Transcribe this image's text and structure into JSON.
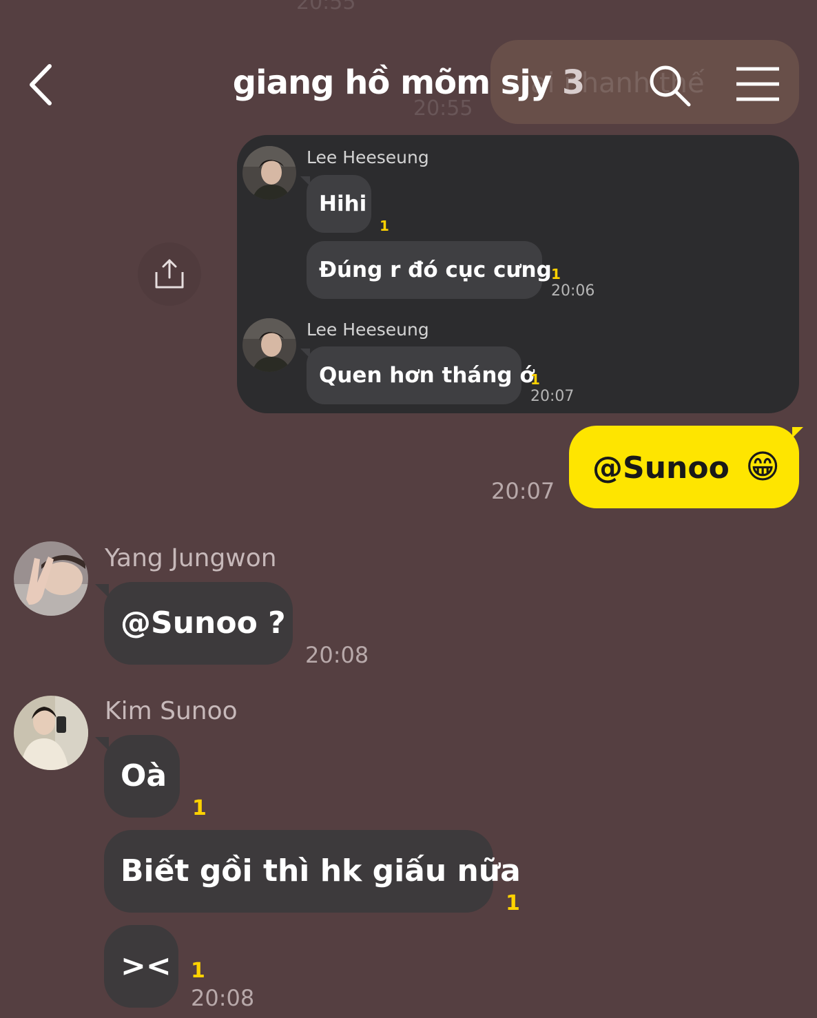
{
  "background_ghost": {
    "top_time": "20:55",
    "mid_time": "20:55",
    "bubble_text": "ai nhanh thế"
  },
  "header": {
    "title": "giang hồ mõm sjy",
    "member_count": "3",
    "back_icon": "chevron-left-icon",
    "search_icon": "search-icon",
    "menu_icon": "hamburger-menu-icon"
  },
  "forwarded": {
    "share_icon": "share-upload-icon",
    "groups": [
      {
        "sender": "Lee Heeseung",
        "messages": [
          {
            "text": "Hihi",
            "unread": "1",
            "time": ""
          },
          {
            "text": "Đúng r đó cục cưng",
            "unread": "1",
            "time": "20:06"
          }
        ]
      },
      {
        "sender": "Lee Heeseung",
        "messages": [
          {
            "text": "Quen hơn tháng ớ",
            "unread": "1",
            "time": "20:07"
          }
        ]
      }
    ]
  },
  "my_message": {
    "text": "@Sunoo",
    "emoji": "😁",
    "time": "20:07"
  },
  "messages": [
    {
      "sender": "Yang Jungwon",
      "bubbles": [
        {
          "text": "@Sunoo ?",
          "unread": "",
          "time": "20:08"
        }
      ]
    },
    {
      "sender": "Kim Sunoo",
      "bubbles": [
        {
          "text": "Oà",
          "unread": "1",
          "time": ""
        },
        {
          "text": "Biết gồi thì hk giấu nữa",
          "unread": "1",
          "time": ""
        },
        {
          "text": "><",
          "unread": "1",
          "time": "20:08"
        }
      ]
    }
  ],
  "colors": {
    "background": "#553f41",
    "my_bubble": "#fee500",
    "other_bubble": "#3d3a3c",
    "unread_count": "#ffd200",
    "forward_card": "#2c2c2e"
  }
}
